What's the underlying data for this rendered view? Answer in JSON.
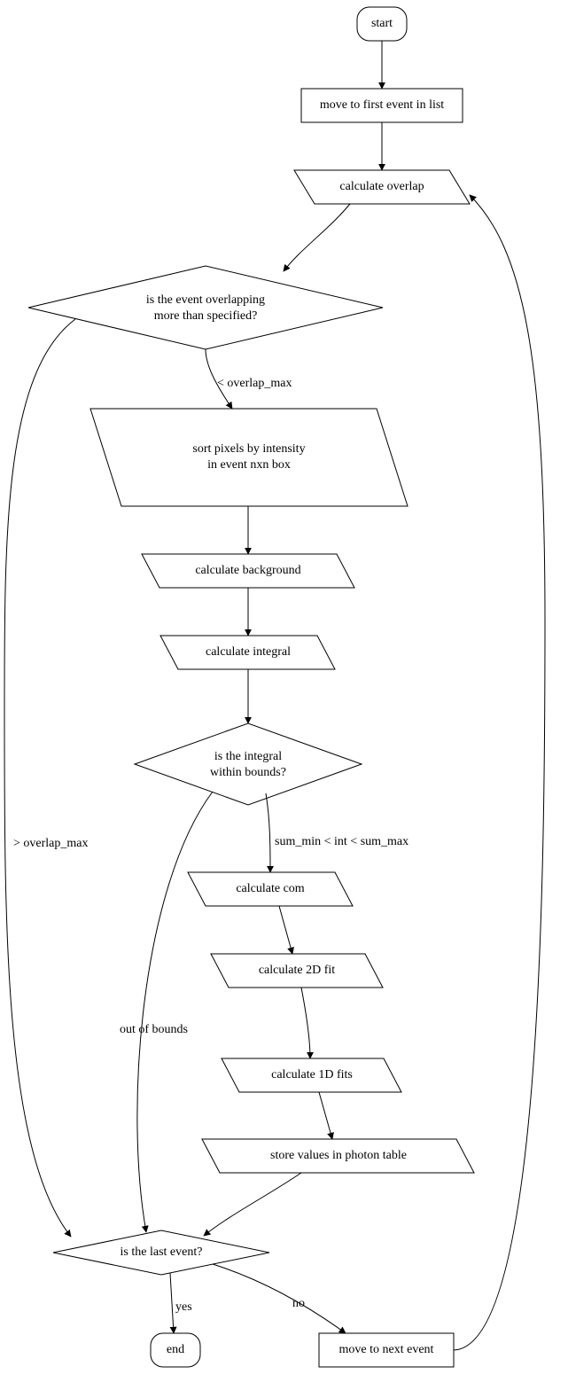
{
  "nodes": {
    "start": {
      "label": "start"
    },
    "first_event": {
      "label": "move to first event in list"
    },
    "calc_overlap": {
      "label": "calculate overlap"
    },
    "overlap_q": {
      "line1": "is the event overlapping",
      "line2": "more than specified?"
    },
    "sort_pixels": {
      "line1": "sort pixels by intensity",
      "line2": "in event nxn box"
    },
    "calc_bg": {
      "label": "calculate background"
    },
    "calc_int": {
      "label": "calculate integral"
    },
    "int_q": {
      "line1": "is the integral",
      "line2": "within bounds?"
    },
    "calc_com": {
      "label": "calculate com"
    },
    "calc_2d": {
      "label": "calculate 2D fit"
    },
    "calc_1d": {
      "label": "calculate 1D fits"
    },
    "store": {
      "label": "store values in photon table"
    },
    "last_q": {
      "label": "is the last event?"
    },
    "end": {
      "label": "end"
    },
    "next_event": {
      "label": "move to next event"
    }
  },
  "edges": {
    "lt_overlap": "< overlap_max",
    "gt_overlap": "> overlap_max",
    "int_ok": "sum_min < int < sum_max",
    "int_bad": "out of bounds",
    "yes": "yes",
    "no": "no"
  }
}
